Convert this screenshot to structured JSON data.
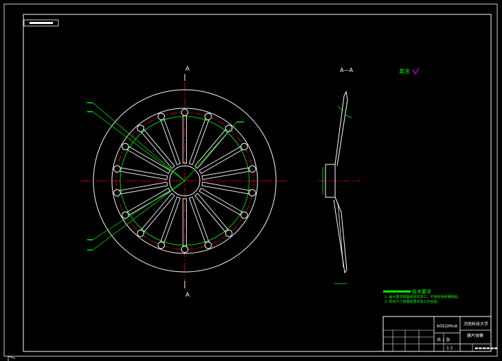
{
  "title_tag": {
    "text": "▬▬▬▬▬▬"
  },
  "views": {
    "section_top": "A",
    "section_bottom": "A",
    "section_title": "A—A",
    "surface_note": "其余"
  },
  "colors": {
    "line": "#ffffff",
    "dimension": "#00ff00",
    "centerline": "#ff0000",
    "accent": "#ff00ff",
    "title_block": "#ffffff",
    "background": "#000000"
  },
  "front_view": {
    "slot_count": 18,
    "hole_count": 18
  },
  "tech_requirements": {
    "heading": "技术要求",
    "items": [
      "1. 盖片要求按图纸规定加工，不得有毛刺等缺陷。",
      "2. 所有尺寸按图纸要求加工并检验。"
    ]
  },
  "title_block": {
    "material": "60Si2MnA",
    "school": "河南科技大学",
    "part_name": "膜片弹簧",
    "scale": "1:1",
    "drawing_no": "▬▬▬▬▬▬",
    "sheet_info": "共 1 张"
  }
}
